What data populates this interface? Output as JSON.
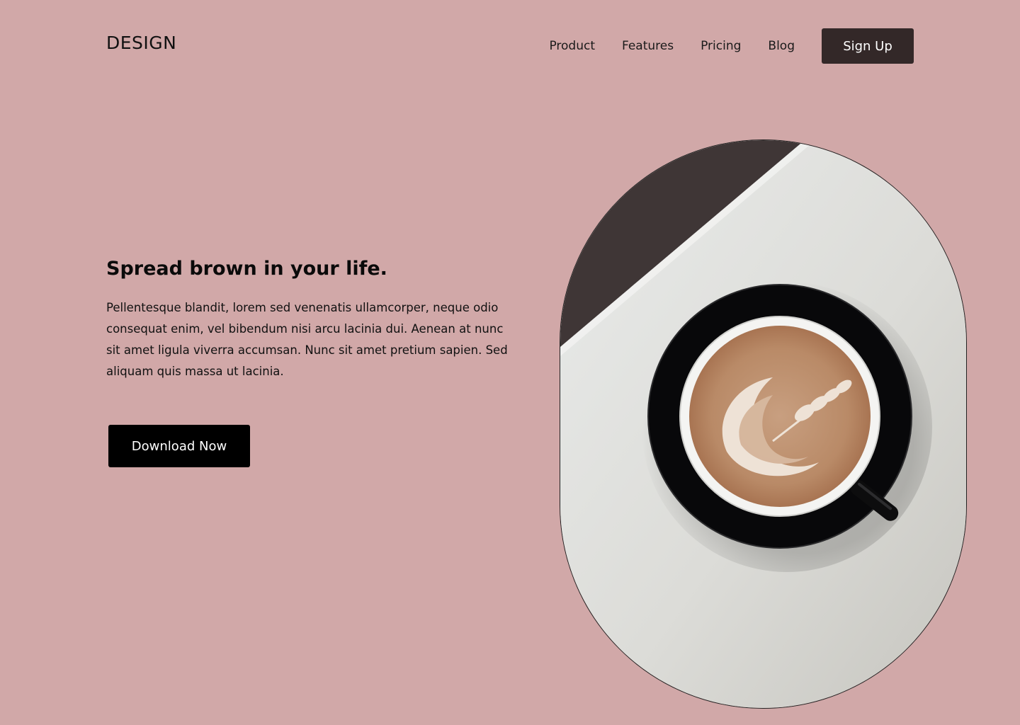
{
  "header": {
    "logo": "DESIGN",
    "nav": [
      "Product",
      "Features",
      "Pricing",
      "Blog"
    ],
    "signup_label": "Sign Up"
  },
  "hero": {
    "headline": "Spread brown in your life.",
    "body": "Pellentesque blandit, lorem sed venenatis ullamcorper, neque odio consequat enim, vel bibendum nisi arcu lacinia dui. Aenean at nunc sit amet ligula viverra accumsan. Nunc sit amet pretium sapien. Sed aliquam quis massa ut lacinia.",
    "cta_label": "Download Now"
  },
  "colors": {
    "background": "#d1a8a8",
    "signup_button": "#332828",
    "cta_button": "#000000"
  }
}
